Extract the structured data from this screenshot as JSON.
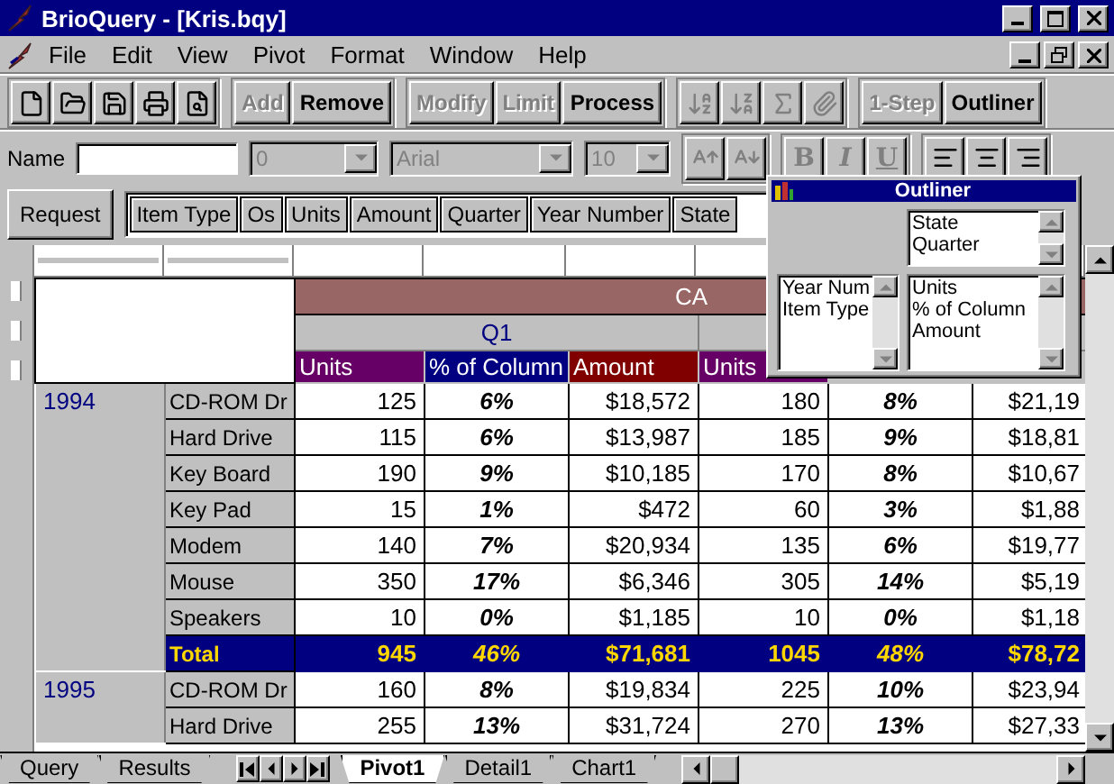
{
  "window": {
    "title": "BrioQuery - [Kris.bqy]"
  },
  "menu": [
    "File",
    "Edit",
    "View",
    "Pivot",
    "Format",
    "Window",
    "Help"
  ],
  "toolbar": {
    "query_buttons": [
      {
        "label": "Add",
        "disabled": true
      },
      {
        "label": "Remove",
        "disabled": false
      }
    ],
    "process_buttons": [
      {
        "label": "Modify",
        "disabled": true
      },
      {
        "label": "Limit",
        "disabled": true
      },
      {
        "label": "Process",
        "disabled": false
      }
    ],
    "tools": [
      {
        "disabled": true
      },
      {
        "disabled": true
      },
      {
        "disabled": true
      },
      {
        "disabled": true
      }
    ],
    "mode_buttons": [
      {
        "label": "1-Step",
        "disabled": true
      },
      {
        "label": "Outliner",
        "disabled": false
      }
    ]
  },
  "format_bar": {
    "name_label": "Name",
    "combos": [
      "0",
      "Arial",
      "10"
    ],
    "style_buttons": [
      "B",
      "I",
      "U"
    ]
  },
  "request": {
    "label": "Request",
    "items": [
      "Item Type",
      "Os",
      "Units",
      "Amount",
      "Quarter",
      "Year Number",
      "State"
    ]
  },
  "pivot": {
    "top_header": "CA",
    "quarter_header": "Q1",
    "measures": [
      {
        "label": "Units",
        "color": "#660066"
      },
      {
        "label": "% of Column",
        "color": "#000080"
      },
      {
        "label": "Amount",
        "color": "#800000"
      },
      {
        "label": "Units",
        "color": "#660066"
      }
    ],
    "groups": [
      {
        "year": "1994",
        "rows": [
          {
            "kind": "item",
            "label": "CD-ROM Dr",
            "cells": [
              "125",
              "6%",
              "$18,572",
              "180",
              "8%",
              "$21,19"
            ]
          },
          {
            "kind": "item",
            "label": "Hard Drive",
            "cells": [
              "115",
              "6%",
              "$13,987",
              "185",
              "9%",
              "$18,81"
            ]
          },
          {
            "kind": "item",
            "label": "Key Board",
            "cells": [
              "190",
              "9%",
              "$10,185",
              "170",
              "8%",
              "$10,67"
            ]
          },
          {
            "kind": "item",
            "label": "Key Pad",
            "cells": [
              "15",
              "1%",
              "$472",
              "60",
              "3%",
              "$1,88"
            ]
          },
          {
            "kind": "item",
            "label": "Modem",
            "cells": [
              "140",
              "7%",
              "$20,934",
              "135",
              "6%",
              "$19,77"
            ]
          },
          {
            "kind": "item",
            "label": "Mouse",
            "cells": [
              "350",
              "17%",
              "$6,346",
              "305",
              "14%",
              "$5,19"
            ]
          },
          {
            "kind": "item",
            "label": "Speakers",
            "cells": [
              "10",
              "0%",
              "$1,185",
              "10",
              "0%",
              "$1,18"
            ]
          },
          {
            "kind": "total",
            "label": "Total",
            "cells": [
              "945",
              "46%",
              "$71,681",
              "1045",
              "48%",
              "$78,72"
            ]
          }
        ]
      },
      {
        "year": "1995",
        "rows": [
          {
            "kind": "item",
            "label": "CD-ROM Dr",
            "cells": [
              "160",
              "8%",
              "$19,834",
              "225",
              "10%",
              "$23,94"
            ]
          },
          {
            "kind": "item",
            "label": "Hard Drive",
            "cells": [
              "255",
              "13%",
              "$31,724",
              "270",
              "13%",
              "$27,33"
            ]
          }
        ]
      }
    ]
  },
  "outliner": {
    "title": "Outliner",
    "columns_list": [
      "State",
      "Quarter"
    ],
    "rows_list": [
      "Year Num",
      "Item Type"
    ],
    "facts_list": [
      "Units",
      "% of Column",
      "Amount"
    ]
  },
  "sheet_tabs": [
    {
      "label": "Query",
      "selected": false
    },
    {
      "label": "Results",
      "selected": false
    },
    {
      "label": "Pivot1",
      "selected": true
    },
    {
      "label": "Detail1",
      "selected": false
    },
    {
      "label": "Chart1",
      "selected": false
    }
  ]
}
